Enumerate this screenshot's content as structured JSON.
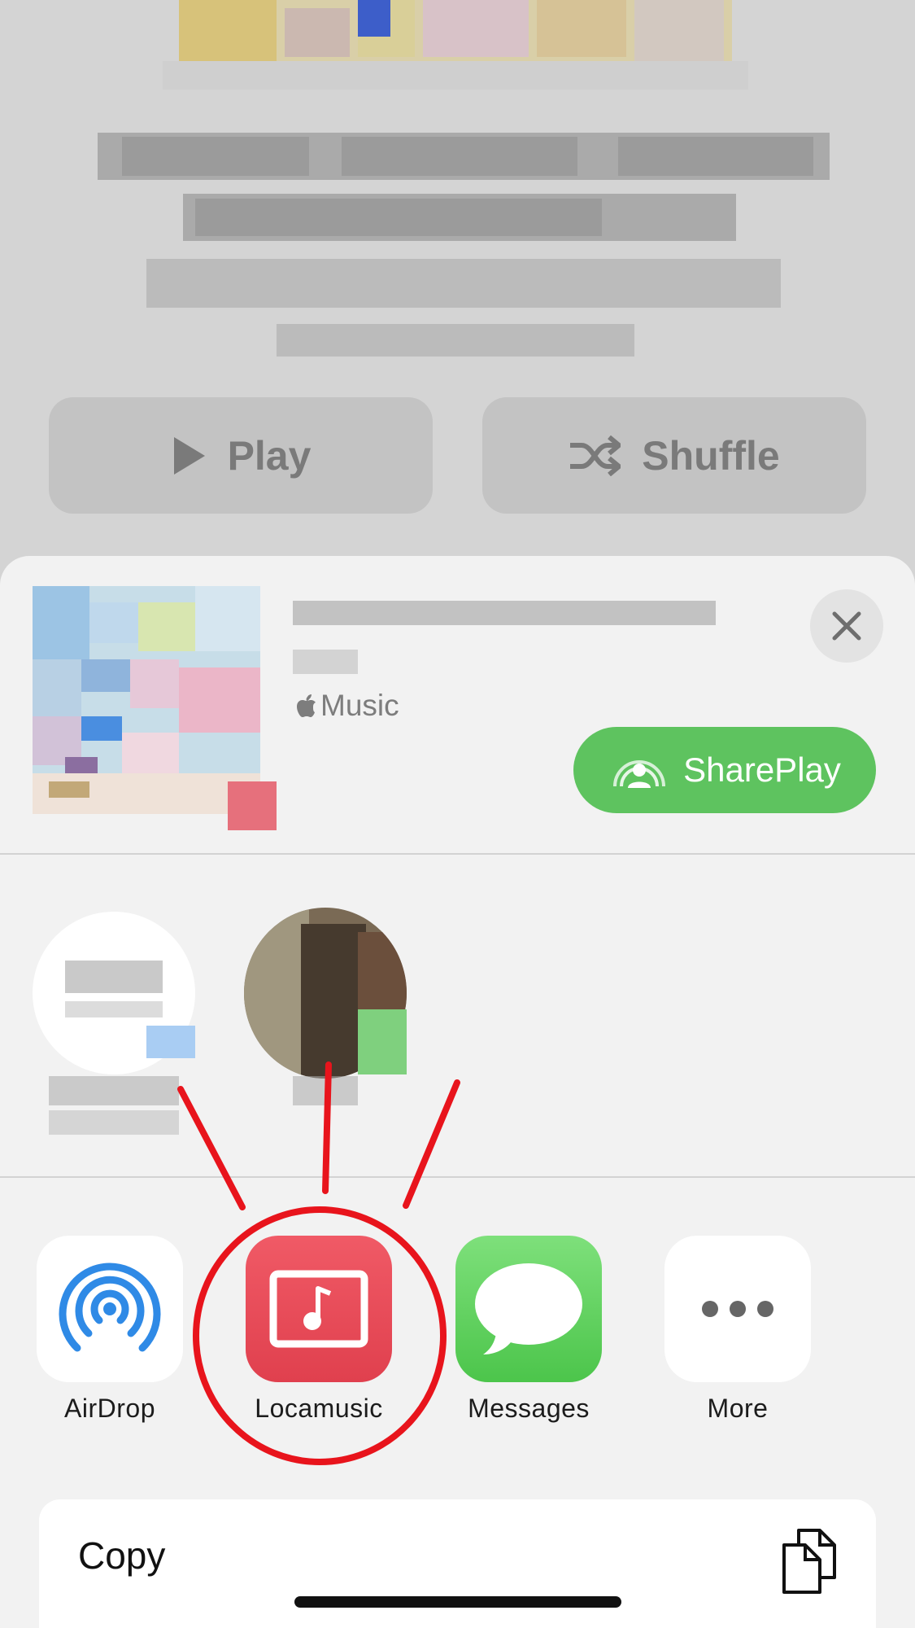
{
  "background": {
    "play_label": "Play",
    "shuffle_label": "Shuffle"
  },
  "share_header": {
    "source": "Music",
    "shareplay_label": "SharePlay"
  },
  "apps": [
    {
      "label": "AirDrop",
      "icon": "airdrop-icon"
    },
    {
      "label": "Locamusic",
      "icon": "locamusic-icon"
    },
    {
      "label": "Messages",
      "icon": "messages-icon"
    },
    {
      "label": "More",
      "icon": "more-icon"
    }
  ],
  "actions": {
    "copy_label": "Copy"
  },
  "colors": {
    "shareplay_green": "#5ec35f",
    "locamusic_red": "#e0404e",
    "messages_green": "#4cc54b",
    "airdrop_blue": "#2f8ae6",
    "annotation_red": "#e8141c"
  }
}
